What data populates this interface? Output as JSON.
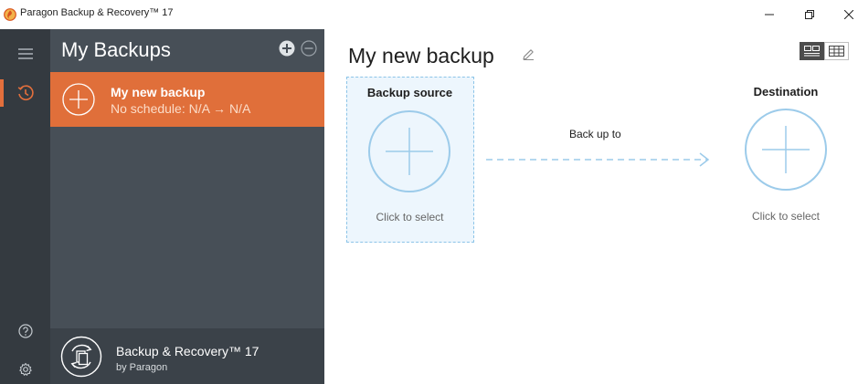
{
  "window": {
    "title": "Paragon Backup & Recovery™ 17",
    "icon": "paragon-app-icon"
  },
  "rail": {
    "items": [
      {
        "icon": "hamburger-menu-icon"
      },
      {
        "icon": "history-clock-icon",
        "active": true
      },
      {
        "icon": "help-icon"
      },
      {
        "icon": "gear-icon"
      }
    ]
  },
  "backups_panel": {
    "title": "My Backups",
    "items": [
      {
        "name": "My new backup",
        "schedule": "No schedule: N/A → N/A",
        "selected": true
      }
    ],
    "footer": {
      "product": "Backup & Recovery™ 17",
      "by": "by Paragon"
    }
  },
  "main": {
    "title": "My new backup",
    "source": {
      "label": "Backup source",
      "hint": "Click to select"
    },
    "link_label": "Back up to",
    "destination": {
      "label": "Destination",
      "hint": "Click to select"
    }
  },
  "colors": {
    "accent": "#e06f3a",
    "rail": "#343a40",
    "panel": "#474f57",
    "panel_footer": "#3b4249",
    "source_fill": "#edf6fd",
    "circle_stroke": "#9ccbea"
  }
}
